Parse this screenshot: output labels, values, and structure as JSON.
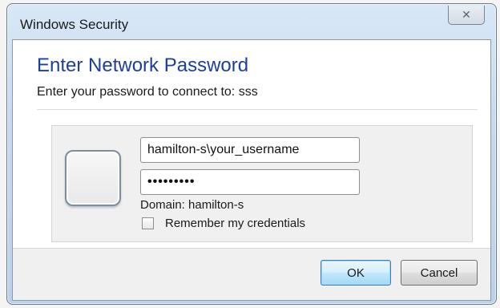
{
  "window": {
    "title": "Windows Security",
    "close_glyph": "✕"
  },
  "dialog": {
    "heading": "Enter Network Password",
    "subheading": "Enter your password to connect to: sss"
  },
  "credentials": {
    "username_value": "hamilton-s\\your_username",
    "password_value": "•••••••••",
    "domain_text": "Domain: hamilton-s",
    "remember_label": "Remember my credentials",
    "remember_checked": false
  },
  "buttons": {
    "ok_label": "OK",
    "cancel_label": "Cancel"
  },
  "colors": {
    "heading": "#1e3e9e",
    "ok_border": "#3c7fb1"
  },
  "icons": {
    "close": "close-icon",
    "user_tile": "user-tile-icon"
  }
}
